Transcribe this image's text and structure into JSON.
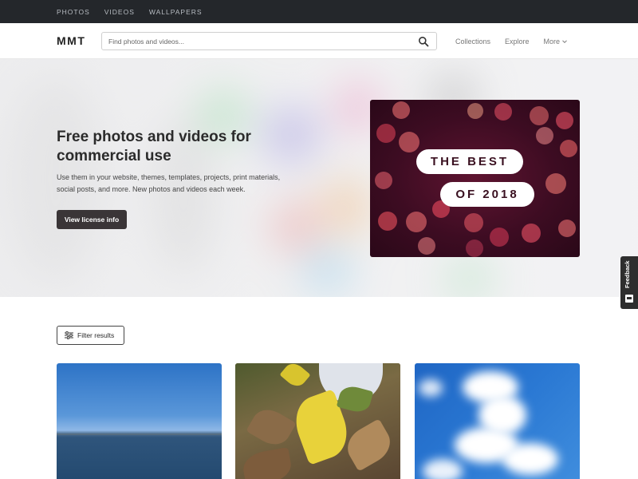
{
  "topbar": {
    "links": [
      "PHOTOS",
      "VIDEOS",
      "WALLPAPERS"
    ]
  },
  "header": {
    "logo": "MMT",
    "search": {
      "placeholder": "Find photos and videos...",
      "value": ""
    },
    "search_icon": "search-icon",
    "nav": {
      "collections": "Collections",
      "explore": "Explore",
      "more": "More"
    }
  },
  "hero": {
    "title": "Free photos and videos for commercial use",
    "subtitle": "Use them in your website, themes, templates, projects, print materials, social posts, and more. New photos and videos each week.",
    "button": "View license info",
    "feature": {
      "line1": "THE BEST",
      "line2": "OF 2018"
    }
  },
  "feedback": {
    "label": "Feedback",
    "icon": "chat-icon"
  },
  "filter": {
    "label": "Filter results",
    "icon": "sliders-icon"
  },
  "colors": {
    "topbar": "#24272b",
    "button_dark": "#3a3537",
    "feature_bg": "#3d0c22"
  }
}
